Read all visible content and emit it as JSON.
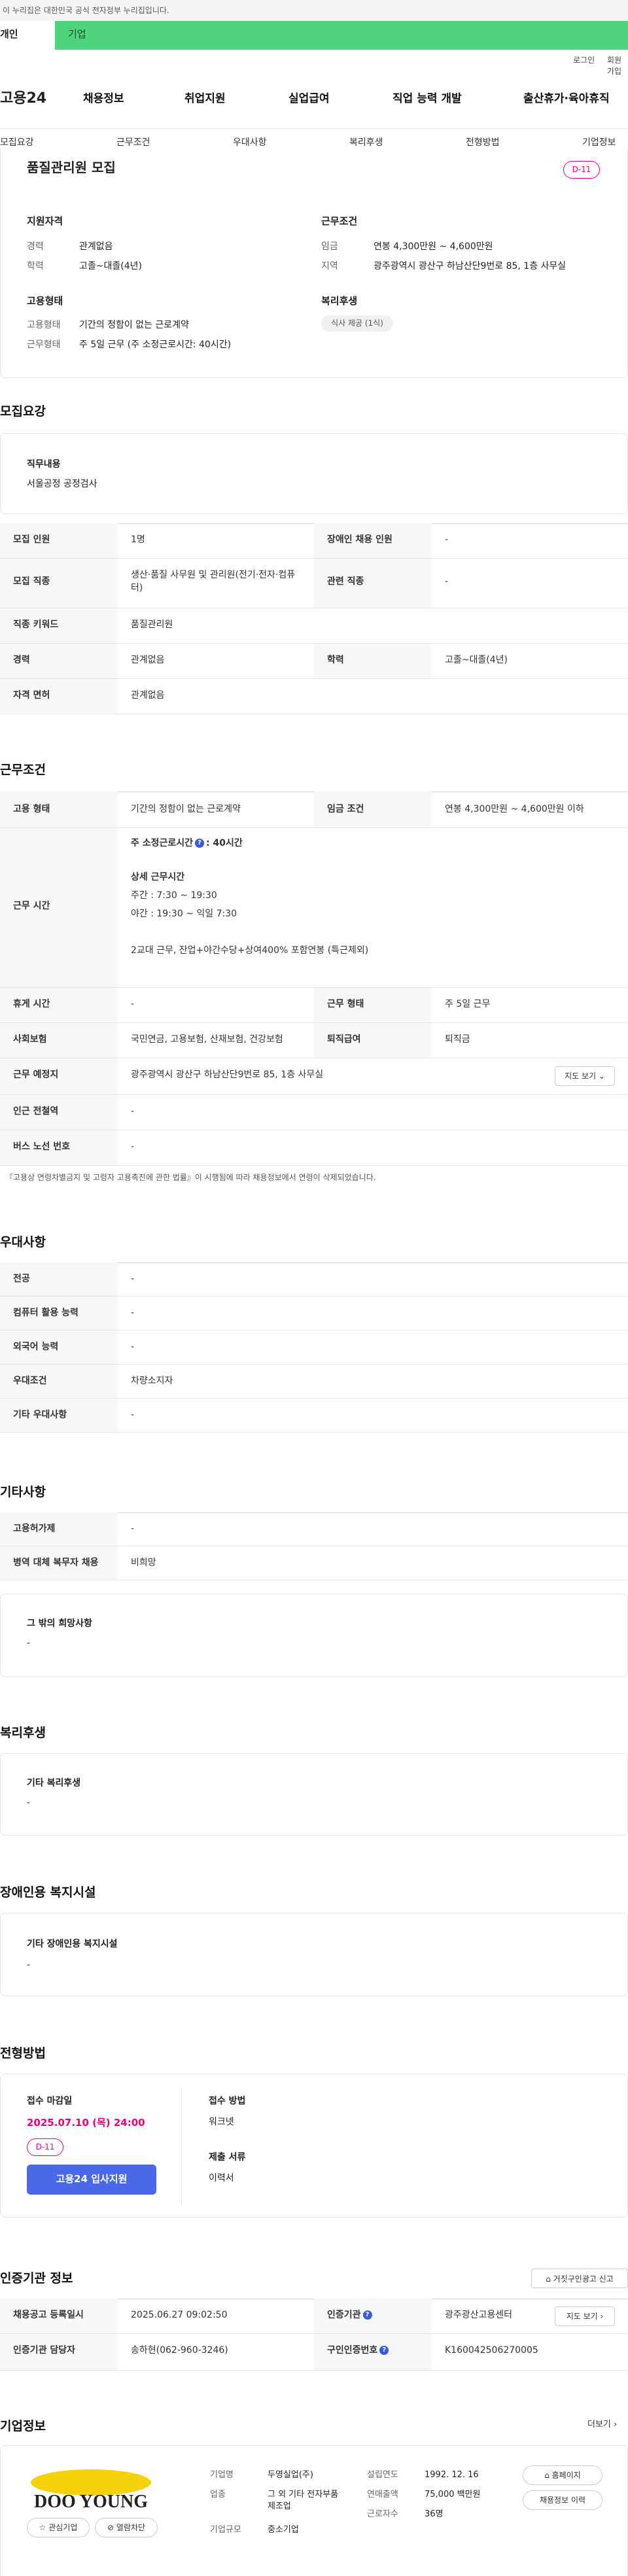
{
  "gov_banner": "이 누리집은 대한민국 공식 전자정부 누리집입니다.",
  "tabs": [
    "개인",
    "기업"
  ],
  "util": {
    "login": "로그인",
    "signup": "회원가입"
  },
  "logo": "고용24",
  "gnav": [
    "채용정보",
    "취업지원",
    "실업급여",
    "직업 능력 개발",
    "출산휴가·육아휴직"
  ],
  "subnav": [
    "모집요강",
    "근무조건",
    "우대사항",
    "복리후생",
    "전형방법",
    "기업정보"
  ],
  "summary": {
    "title": "품질관리원 모집",
    "dday": "D-11",
    "qual_title": "지원자격",
    "career_label": "경력",
    "career": "관계없음",
    "edu_label": "학력",
    "edu": "고졸~대졸(4년)",
    "emp_title": "고용형태",
    "emp_label": "고용형태",
    "emp": "기간의 정함이 없는 근로계약",
    "work_label": "근무형태",
    "work": "주 5일 근무 (주 소정근로시간: 40시간)",
    "cond_title": "근무조건",
    "wage_label": "임금",
    "wage": "연봉 4,300만원 ~ 4,600만원",
    "region_label": "지역",
    "region": "광주광역시 광산구 하남산단9번로 85, 1층 사무실",
    "welfare_title": "복리후생",
    "welfare_pill": "식사 제공 (1식)"
  },
  "recruit": {
    "heading": "모집요강",
    "job_title": "직무내용",
    "job": "서울공정 공정검사",
    "rows": [
      [
        "모집 인원",
        "1명",
        "장애인 채용 인원",
        "-"
      ],
      [
        "모집 직종",
        "생산·품질 사무원 및 관리원(전기·전자·컴퓨터)",
        "관련 직종",
        "-"
      ],
      [
        "직종 키워드",
        "품질관리원",
        "",
        ""
      ],
      [
        "경력",
        "관계없음",
        "학력",
        "고졸~대졸(4년)"
      ],
      [
        "자격 면허",
        "관계없음",
        "",
        ""
      ]
    ]
  },
  "cond": {
    "heading": "근무조건",
    "emp_th": "고용 형태",
    "emp": "기간의 정함이 없는 근로계약",
    "wage_th": "임금 조건",
    "wage": "연봉 4,300만원 ~ 4,600만원 이하",
    "time_th": "근무 시간",
    "hours_label": "주 소정근로시간",
    "hours": ": 40시간",
    "detail_title": "상세 근무시간",
    "day": "주간 : 7:30 ~ 19:30",
    "night": "야간 : 19:30 ~ 익일 7:30",
    "shift": "2교대 근무, 잔업+야간수당+상여400% 포함연봉 (특근제외)",
    "rest_th": "휴게 시간",
    "rest": "-",
    "worktype_th": "근무 형태",
    "worktype": "주 5일 근무",
    "ins_th": "사회보험",
    "ins": "국민연금, 고용보험, 산재보험, 건강보험",
    "retire_th": "퇴직급여",
    "retire": "퇴직금",
    "place_th": "근무 예정지",
    "place": "광주광역시 광산구 하남산단9번로 85, 1층 사무실",
    "map_btn": "지도 보기",
    "subway_th": "인근 전철역",
    "subway": "-",
    "bus_th": "버스 노선 번호",
    "bus": "-",
    "notice": "『고용상 연령차별금지 및 고령자 고용촉진에 관한 법률』이 시행됨에 따라 채용정보에서 연령이 삭제되었습니다."
  },
  "pref": {
    "heading": "우대사항",
    "rows": [
      [
        "전공",
        "-"
      ],
      [
        "컴퓨터 활용 능력",
        "-"
      ],
      [
        "외국어 능력",
        "-"
      ],
      [
        "우대조건",
        "차량소지자"
      ],
      [
        "기타 우대사항",
        "-"
      ]
    ]
  },
  "etc": {
    "heading": "기타사항",
    "rows": [
      [
        "고용허가제",
        "-"
      ],
      [
        "병역 대체 복무자 채용",
        "비희망"
      ]
    ],
    "box_title": "그 밖의 희망사항",
    "box_val": "-"
  },
  "welfare": {
    "heading": "복리후생",
    "box_title": "기타 복리후생",
    "box_val": "-"
  },
  "disab": {
    "heading": "장애인용 복지시설",
    "box_title": "기타 장애인용 복지시설",
    "box_val": "-"
  },
  "select": {
    "heading": "전형방법",
    "deadline_title": "접수 마감일",
    "deadline": "2025.07.10 (목) 24:00",
    "dday": "D-11",
    "apply": "고용24 입사지원",
    "method_title": "접수 방법",
    "method": "워크넷",
    "docs_title": "제출 서류",
    "docs": "이력서"
  },
  "cert": {
    "heading": "인증기관 정보",
    "report_btn": "거짓구인광고 신고",
    "reg_th": "채용공고 등록일시",
    "reg": "2025.06.27 09:02:50",
    "agency_th": "인증기관",
    "agency": "광주광산고용센터",
    "mgr_th": "인증기관 담당자",
    "mgr": "송하현(062-960-3246)",
    "no_th": "구인인증번호",
    "no": "K160042506270005",
    "dir_btn": "지도 보기"
  },
  "company": {
    "heading": "기업정보",
    "more": "더보기",
    "logo_text": "DOO YOUNG",
    "fav_btn": "관심기업",
    "block_btn": "열람차단",
    "name_label": "기업명",
    "name": "두영실업(주)",
    "biz_label": "업종",
    "biz": "그 외 기타 전자부품 제조업",
    "scale_label": "기업규모",
    "scale": "중소기업",
    "est_label": "설립연도",
    "est": "1992. 12. 16",
    "sales_label": "연매출액",
    "sales": "75,000 백만원",
    "staff_label": "근로자수",
    "staff": "36명",
    "home_btn": "홈페이지",
    "history_btn": "채용정보 이력"
  }
}
